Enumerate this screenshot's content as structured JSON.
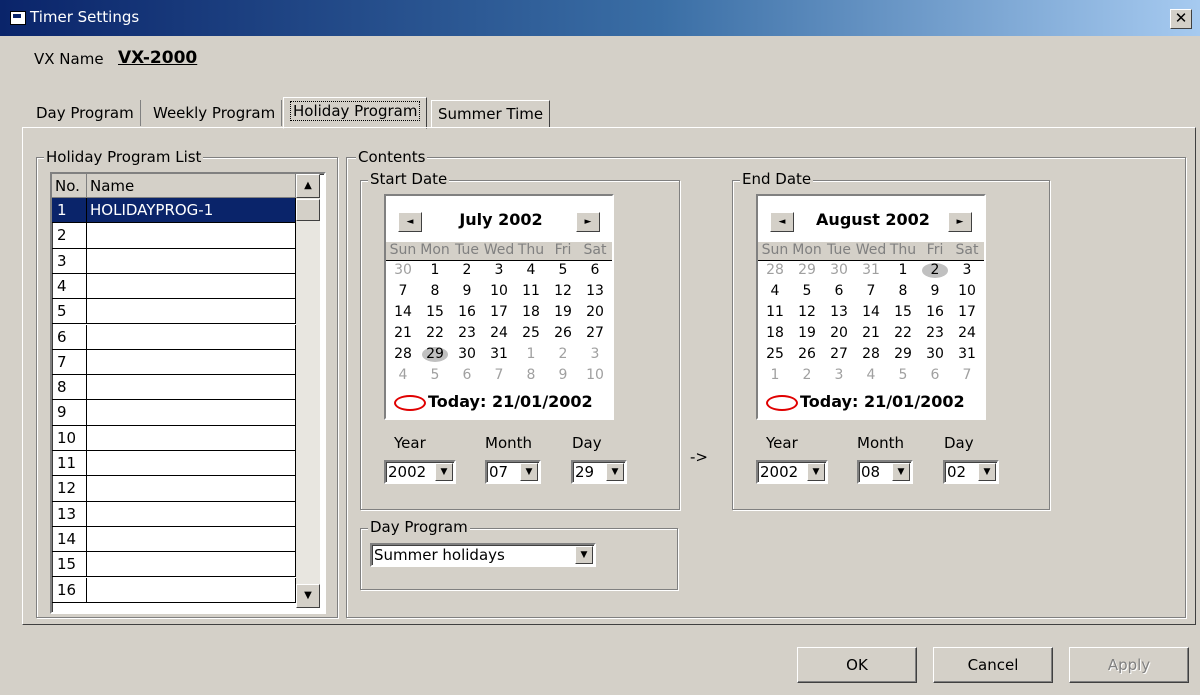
{
  "window": {
    "title": "Timer Settings",
    "close_glyph": "✕"
  },
  "vx": {
    "label": "VX Name",
    "value": "VX-2000"
  },
  "tabs": [
    "Day Program",
    "Weekly Program",
    "Holiday Program",
    "Summer Time"
  ],
  "active_tab": "Holiday Program",
  "holiday_list": {
    "title": "Holiday Program List",
    "headers": [
      "No.",
      "Name"
    ],
    "rows": [
      {
        "no": "1",
        "name": "HOLIDAYPROG-1",
        "selected": true
      },
      {
        "no": "2",
        "name": ""
      },
      {
        "no": "3",
        "name": ""
      },
      {
        "no": "4",
        "name": ""
      },
      {
        "no": "5",
        "name": ""
      },
      {
        "no": "6",
        "name": ""
      },
      {
        "no": "7",
        "name": ""
      },
      {
        "no": "8",
        "name": ""
      },
      {
        "no": "9",
        "name": ""
      },
      {
        "no": "10",
        "name": ""
      },
      {
        "no": "11",
        "name": ""
      },
      {
        "no": "12",
        "name": ""
      },
      {
        "no": "13",
        "name": ""
      },
      {
        "no": "14",
        "name": ""
      },
      {
        "no": "15",
        "name": ""
      },
      {
        "no": "16",
        "name": ""
      }
    ]
  },
  "contents": {
    "title": "Contents",
    "arrow": "->",
    "start": {
      "title": "Start Date",
      "calendar": {
        "month_title": "July 2002",
        "dow": [
          "Sun",
          "Mon",
          "Tue",
          "Wed",
          "Thu",
          "Fri",
          "Sat"
        ],
        "weeks": [
          [
            "30",
            "1",
            "2",
            "3",
            "4",
            "5",
            "6"
          ],
          [
            "7",
            "8",
            "9",
            "10",
            "11",
            "12",
            "13"
          ],
          [
            "14",
            "15",
            "16",
            "17",
            "18",
            "19",
            "20"
          ],
          [
            "21",
            "22",
            "23",
            "24",
            "25",
            "26",
            "27"
          ],
          [
            "28",
            "29",
            "30",
            "31",
            "1",
            "2",
            "3"
          ],
          [
            "4",
            "5",
            "6",
            "7",
            "8",
            "9",
            "10"
          ]
        ],
        "other_month": [
          [
            0,
            0
          ],
          [
            4,
            4
          ],
          [
            4,
            5
          ],
          [
            4,
            6
          ],
          [
            5,
            0
          ],
          [
            5,
            1
          ],
          [
            5,
            2
          ],
          [
            5,
            3
          ],
          [
            5,
            4
          ],
          [
            5,
            5
          ],
          [
            5,
            6
          ]
        ],
        "highlight": [
          4,
          1
        ],
        "today": "Today: 21/01/2002"
      },
      "year_label": "Year",
      "month_label": "Month",
      "day_label": "Day",
      "year": "2002",
      "month": "07",
      "day": "29"
    },
    "end": {
      "title": "End Date",
      "calendar": {
        "month_title": "August 2002",
        "dow": [
          "Sun",
          "Mon",
          "Tue",
          "Wed",
          "Thu",
          "Fri",
          "Sat"
        ],
        "weeks": [
          [
            "28",
            "29",
            "30",
            "31",
            "1",
            "2",
            "3"
          ],
          [
            "4",
            "5",
            "6",
            "7",
            "8",
            "9",
            "10"
          ],
          [
            "11",
            "12",
            "13",
            "14",
            "15",
            "16",
            "17"
          ],
          [
            "18",
            "19",
            "20",
            "21",
            "22",
            "23",
            "24"
          ],
          [
            "25",
            "26",
            "27",
            "28",
            "29",
            "30",
            "31"
          ],
          [
            "1",
            "2",
            "3",
            "4",
            "5",
            "6",
            "7"
          ]
        ],
        "other_month": [
          [
            0,
            0
          ],
          [
            0,
            1
          ],
          [
            0,
            2
          ],
          [
            0,
            3
          ],
          [
            5,
            0
          ],
          [
            5,
            1
          ],
          [
            5,
            2
          ],
          [
            5,
            3
          ],
          [
            5,
            4
          ],
          [
            5,
            5
          ],
          [
            5,
            6
          ]
        ],
        "highlight": [
          0,
          5
        ],
        "today": "Today: 21/01/2002"
      },
      "year_label": "Year",
      "month_label": "Month",
      "day_label": "Day",
      "year": "2002",
      "month": "08",
      "day": "02"
    },
    "day_program": {
      "title": "Day Program",
      "value": "Summer holidays"
    }
  },
  "buttons": {
    "ok": "OK",
    "cancel": "Cancel",
    "apply": "Apply"
  }
}
